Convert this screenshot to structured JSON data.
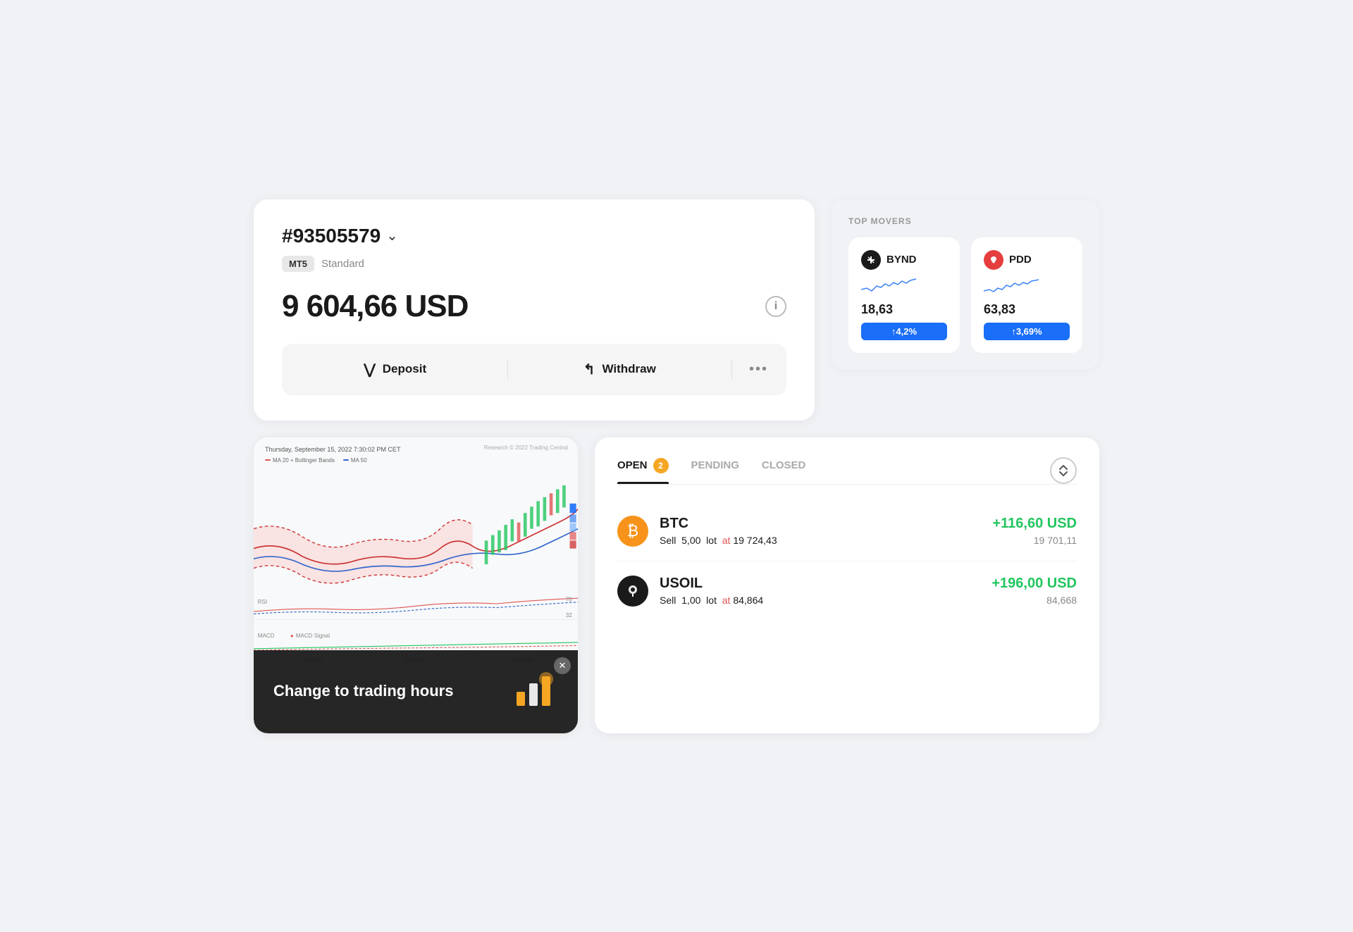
{
  "account": {
    "id": "#93505579",
    "platform": "MT5",
    "type": "Standard",
    "balance": "9 604,66",
    "currency": "USD",
    "deposit_label": "Deposit",
    "withdraw_label": "Withdraw"
  },
  "top_movers": {
    "title": "TOP MOVERS",
    "items": [
      {
        "symbol": "BYND",
        "price": "18,63",
        "change": "↑4,2%",
        "logo_text": "✕"
      },
      {
        "symbol": "PDD",
        "price": "63,83",
        "change": "↑3,69%",
        "logo_text": "♥"
      }
    ]
  },
  "chart": {
    "timestamp": "Thursday, September 15, 2022 7:30:02 PM CET",
    "copyright": "Research © 2022 Trading Central",
    "legend": [
      {
        "label": "MA 20 + Bollinger Bands",
        "color": "#e05555"
      },
      {
        "label": "MA 50",
        "color": "#3366cc"
      }
    ]
  },
  "notification": {
    "text": "Change to trading hours",
    "icon": "📊"
  },
  "trades": {
    "tabs": [
      {
        "label": "OPEN",
        "badge": "2",
        "active": true
      },
      {
        "label": "PENDING",
        "badge": null,
        "active": false
      },
      {
        "label": "CLOSED",
        "badge": null,
        "active": false
      }
    ],
    "items": [
      {
        "symbol": "BTC",
        "type": "Sell",
        "lots": "5,00",
        "unit": "lot",
        "open_price": "19 724,43",
        "current_price": "19 701,11",
        "pnl": "+116,60",
        "currency": "USD",
        "logo_type": "btc",
        "logo_text": "₿"
      },
      {
        "symbol": "USOIL",
        "type": "Sell",
        "lots": "1,00",
        "unit": "lot",
        "open_price": "84,864",
        "current_price": "84,668",
        "pnl": "+196,00",
        "currency": "USD",
        "logo_type": "usoil",
        "logo_text": "💧"
      }
    ]
  }
}
